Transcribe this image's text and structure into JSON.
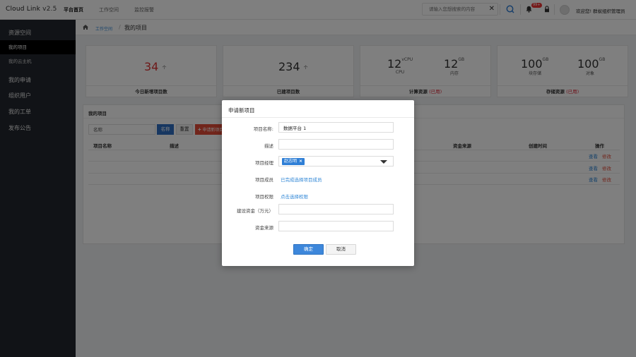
{
  "app": {
    "brand": "Cloud Link",
    "version": "v2.5"
  },
  "topnav": [
    "平台首页",
    "工作空间",
    "监控报警"
  ],
  "search": {
    "placeholder": "请输入您想搜索的内容"
  },
  "notifications": {
    "badge": "99+"
  },
  "user": {
    "welcome": "欢迎您! 群蚁组织管理员"
  },
  "sidebar": {
    "items": [
      {
        "label": "资源空间"
      },
      {
        "label": "我的项目"
      },
      {
        "label": "我的云主机"
      },
      {
        "label": "我的申请"
      },
      {
        "label": "组织用户"
      },
      {
        "label": "我的工单"
      },
      {
        "label": "发布公告"
      }
    ]
  },
  "breadcrumb": {
    "link": "工作空间",
    "separator": "/",
    "current": "我的项目"
  },
  "stats": {
    "new_projects": {
      "value": "34",
      "unit": "个",
      "label": "今日新增项目数"
    },
    "built_projects": {
      "value": "234",
      "unit": "个",
      "label": "已建项目数"
    },
    "compute": {
      "vcpu_value": "12",
      "vcpu_unit": "vCPU",
      "vcpu_label": "CPU",
      "mem_value": "12",
      "mem_unit": "GB",
      "mem_label": "内存",
      "label": "计算资源",
      "status": "(已用)"
    },
    "storage": {
      "block_value": "100",
      "block_unit": "GB",
      "block_label": "块存储",
      "obj_value": "100",
      "obj_unit": "GB",
      "obj_label": "对象",
      "label": "存储资源",
      "status": "(已用)"
    }
  },
  "projects": {
    "title": "我的项目",
    "filter_placeholder": "名称",
    "btn_name": "名称",
    "btn_reset": "重置",
    "btn_apply": "申请新项目",
    "headers": [
      "项目名称",
      "描述",
      "资金来源",
      "创建时间",
      "操作"
    ],
    "row_actions": {
      "view": "查看",
      "edit": "修改"
    },
    "row_count": 3
  },
  "modal": {
    "title": "申请新项目",
    "fields": {
      "name_label": "项目名称:",
      "name_value": "数据平台 1",
      "desc_label": "描述",
      "manager_label": "项目经理",
      "manager_tag": "赵志明",
      "members_label": "项目成员",
      "members_link": "已完成选择项目成员",
      "perms_label": "项目权限",
      "perms_link": "点击选择权限",
      "funds_label": "建设资金（万元）",
      "source_label": "资金来源"
    },
    "ok": "确定",
    "cancel": "取消"
  },
  "colors": {
    "primary": "#3d87db",
    "danger": "#e24a36",
    "sidebar_bg": "#23272e"
  }
}
